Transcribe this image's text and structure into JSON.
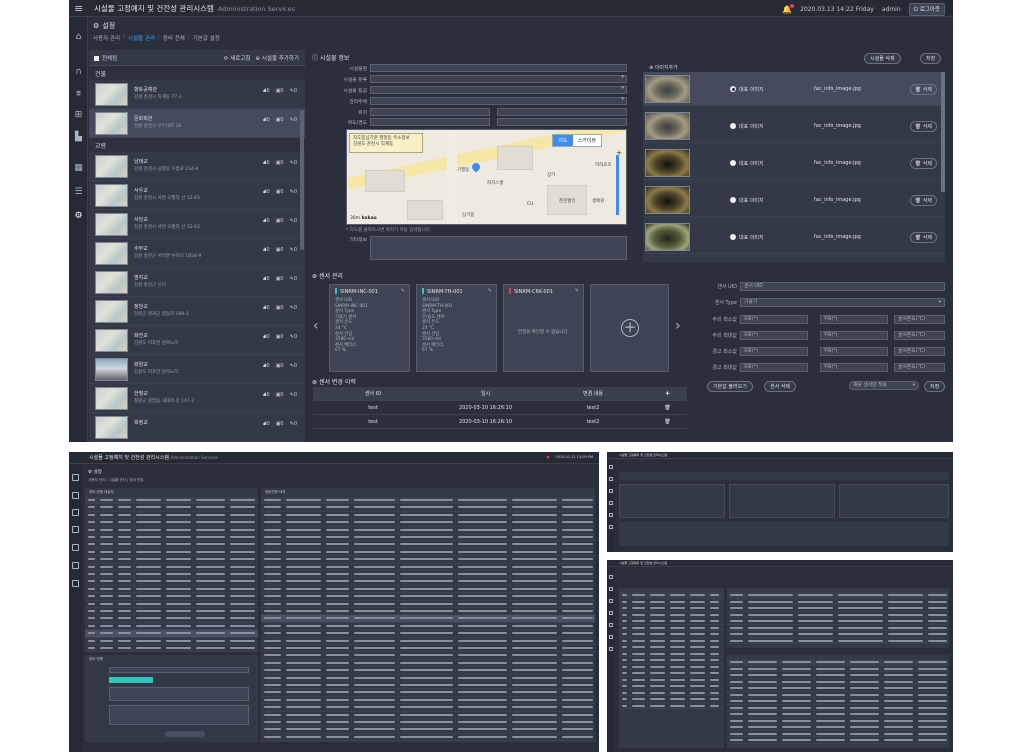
{
  "header": {
    "title": "시설물 고정예지 및 건전성 관리시스템",
    "subtitle": "Administration Services",
    "datetime": "2020.03.13 14:22 Friday",
    "user": "admin",
    "logout_label": "로그아웃"
  },
  "page": {
    "title": "설정",
    "tabs": [
      "사용자 관리",
      "시설물 관리",
      "장비 전체",
      "기본값 설정"
    ],
    "active_tab": "시설물 관리"
  },
  "facility_list": {
    "select_all_label": "전체됨",
    "refresh_label": "새로고침",
    "add_label": "시설물 추가하기",
    "groups": [
      {
        "name": "건물",
        "items": [
          {
            "name": "향토공예관",
            "address": "강원 춘천시 직계동 77-3",
            "count_a": "0",
            "count_b": "0",
            "count_c": "0",
            "thumb": "map"
          },
          {
            "name": "문화회관",
            "address": "강원 춘천시 우두대로 16",
            "count_a": "0",
            "count_b": "0",
            "count_c": "0",
            "thumb": "map",
            "selected": true
          }
        ]
      },
      {
        "name": "교량",
        "items": [
          {
            "name": "남태교",
            "address": "강원 춘천시 공평동 우름로 234-9",
            "count_a": "0",
            "count_b": "0",
            "count_c": "0",
            "thumb": "map"
          },
          {
            "name": "서우교",
            "address": "강원 춘천시 서면 오월리 산 12-43",
            "count_a": "0",
            "count_b": "0",
            "count_c": "0",
            "thumb": "map"
          },
          {
            "name": "서당교",
            "address": "강원 춘천시 서면 오월리 산 12-63",
            "count_a": "0",
            "count_b": "0",
            "count_c": "0",
            "thumb": "map"
          },
          {
            "name": "수무교",
            "address": "강원 홍천군 서석면 수하리 1654-9",
            "count_a": "0",
            "count_b": "0",
            "count_c": "0",
            "thumb": "map"
          },
          {
            "name": "명지교",
            "address": "강원 홍천군 신지",
            "count_a": "0",
            "count_b": "0",
            "count_c": "0",
            "thumb": "map"
          },
          {
            "name": "정당교",
            "address": "강원군 영귀군 영동리 198-3",
            "count_a": "0",
            "count_b": "0",
            "count_c": "0",
            "thumb": "map"
          },
          {
            "name": "화전교",
            "address": "강원도 미포한 원하노리",
            "count_a": "0",
            "count_b": "0",
            "count_c": "0",
            "thumb": "map"
          },
          {
            "name": "화양교",
            "address": "강원도 미포한 원하노리",
            "count_a": "0",
            "count_b": "0",
            "count_c": "0",
            "thumb": "photo"
          },
          {
            "name": "한빛교",
            "address": "철원군 갈말읍 내대리 산 147-2",
            "count_a": "0",
            "count_b": "0",
            "count_c": "0",
            "thumb": "map"
          },
          {
            "name": "희정교",
            "address": "",
            "count_a": "0",
            "count_b": "0",
            "count_c": "0",
            "thumb": "map"
          }
        ]
      }
    ]
  },
  "facility_info": {
    "title": "시설물 정보",
    "delete_label": "시설물 삭제",
    "save_label": "저장",
    "fields": [
      {
        "label": "시설물명",
        "value": "",
        "type": "text"
      },
      {
        "label": "시설물 분류",
        "value": "",
        "type": "select"
      },
      {
        "label": "시설물 등급",
        "value": "",
        "type": "select"
      },
      {
        "label": "관리주체",
        "value": "",
        "type": "select"
      },
      {
        "label": "위치",
        "value": "",
        "type": "text"
      },
      {
        "label": "위도/경도",
        "value": "",
        "type": "text"
      }
    ],
    "map": {
      "tooltip_line1": "지도중심기준 행정동 주소정보",
      "tooltip_line2": "강원도 춘천시 직계동",
      "mode_map": "지도",
      "mode_sky": "스카이뷰",
      "scale_label": "30m",
      "brand": "kakao",
      "labels": [
        "기행동",
        "피자스쿨",
        "상가",
        "춘천할인",
        "상가동",
        "CU",
        "생애원",
        "하하호호"
      ]
    },
    "map_hint": "* 지도를 클릭하시면 위치가 자동 입력됩니다.",
    "memo_label": "기타정보"
  },
  "images": {
    "title": "이미지추가",
    "rows": [
      {
        "label": "대표 이미지",
        "file": "fac_info_image.jpg",
        "delete": "삭제",
        "selected": true,
        "tone": "tunnel"
      },
      {
        "label": "대표 이미지",
        "file": "fac_info_image.jpg",
        "delete": "삭제",
        "selected": false,
        "tone": "tunnel"
      },
      {
        "label": "대표 이미지",
        "file": "fac_info_image.jpg",
        "delete": "삭제",
        "selected": false,
        "tone": "dark"
      },
      {
        "label": "대표 이미지",
        "file": "fac_info_image.jpg",
        "delete": "삭제",
        "selected": false,
        "tone": "dark"
      },
      {
        "label": "대표 이미지",
        "file": "fac_info_image.jpg",
        "delete": "삭제",
        "selected": false,
        "tone": "green"
      }
    ]
  },
  "sensors": {
    "title": "센서 관리",
    "cards": [
      {
        "name": "SINRM-INC-001",
        "color": "#2fc7c0",
        "lines": [
          "센서 UID",
          "SINRM-INC-001",
          "센서 Type",
          "기울기 센서",
          "센서 온도",
          "24 °C",
          "센서 전압",
          "3580 mV",
          "센서 배터리",
          "67 %"
        ]
      },
      {
        "name": "SINRM-TH-001",
        "color": "#2fc7c0",
        "lines": [
          "센서 UID",
          "SINRM-TH-001",
          "센서 Type",
          "온/습도 센서",
          "센서 온도",
          "24 °C",
          "센서 전압",
          "3580 mV",
          "센서 배터리",
          "67 %"
        ]
      },
      {
        "name": "SINRM-CRK-001",
        "color": "#e8366a",
        "empty": "연결을 확인할 수 없습니다."
      }
    ]
  },
  "history": {
    "title": "센서 변경 이력",
    "columns": [
      "센서 ID",
      "일시",
      "변경 내용"
    ],
    "rows": [
      {
        "id": "test",
        "date": "2020-03-10 16:26:10",
        "change": "test2"
      },
      {
        "id": "test",
        "date": "2020-03-10 16:26:10",
        "change": "test2"
      }
    ]
  },
  "sensor_config": {
    "uid_label": "센서 UID",
    "uid_placeholder": "센서 UID",
    "type_label": "센서 Type",
    "type_value": "기울기",
    "rows": [
      {
        "label": "주의 최소값",
        "x": "X축(°)",
        "y": "Y축(°)",
        "t": "센서온도(°C)"
      },
      {
        "label": "주의 최대값",
        "x": "X축(°)",
        "y": "Y축(°)",
        "t": "센서온도(°C)"
      },
      {
        "label": "경고 최소값",
        "x": "X축(°)",
        "y": "Y축(°)",
        "t": "센서온도(°C)"
      },
      {
        "label": "경고 최대값",
        "x": "X축(°)",
        "y": "Y축(°)",
        "t": "센서온도(°C)"
      }
    ],
    "default_btn": "기본값 불러오기",
    "delete_btn": "센서 삭제",
    "apply_select": "해당 센서만 적용",
    "save_btn": "저장"
  },
  "screenshot_b": {
    "title": "시설물 고정예지 및 건전성 관리시스템",
    "subtitle": "Administration Services",
    "datetime": "2020.02.12 13:09 PM",
    "page_title": "설정",
    "tabs": "사용자 관리 | 시설물 관리 | 장비 전체",
    "left_title": "장비 전체 대상자",
    "right_title": "장비전체 내역",
    "info_title": "장비 전체"
  }
}
